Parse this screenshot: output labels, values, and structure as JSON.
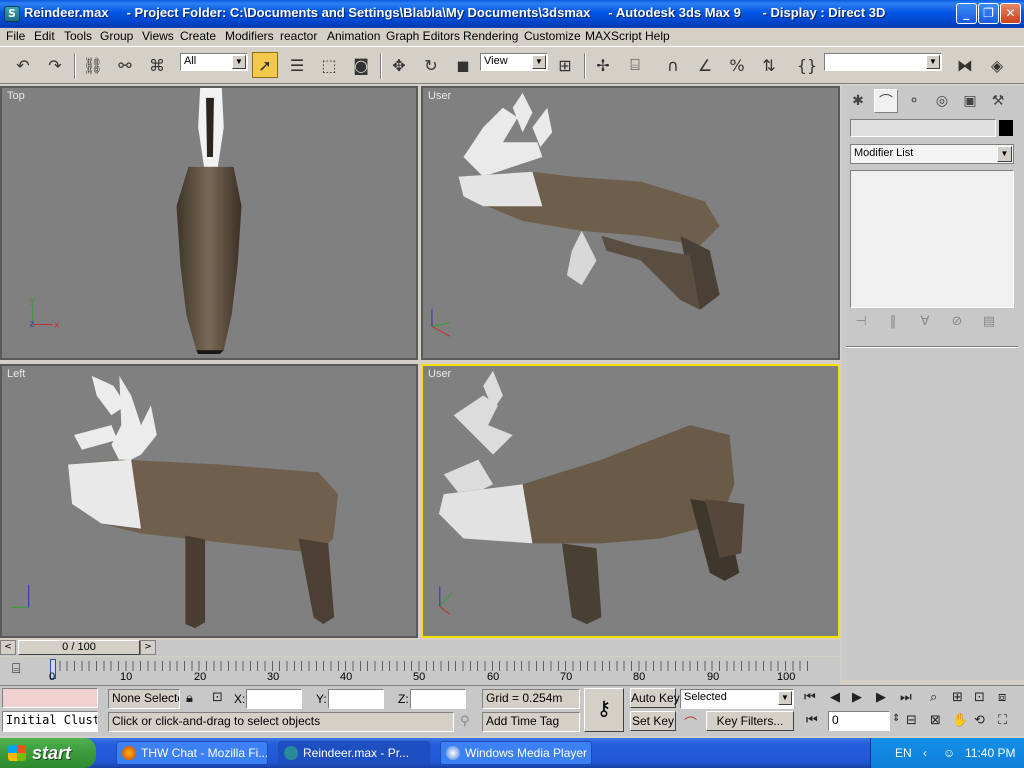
{
  "window": {
    "title": "Reindeer.max     - Project Folder: C:\\Documents and Settings\\Blabla\\My Documents\\3dsmax     - Autodesk 3ds Max 9      - Display : Direct 3D",
    "minimize": "_",
    "maximize": "❐",
    "close": "✕"
  },
  "menu": [
    "File",
    "Edit",
    "Tools",
    "Group",
    "Views",
    "Create",
    "Modifiers",
    "reactor",
    "Animation",
    "Graph Editors",
    "Rendering",
    "Customize",
    "MAXScript",
    "Help"
  ],
  "toolbar": {
    "selection_filter": "All",
    "reference_coord": "View",
    "named_selection": ""
  },
  "viewports": {
    "top_left": "Top",
    "top_right": "User",
    "bottom_left": "Left",
    "bottom_right": "User"
  },
  "command_panel": {
    "modifier_list": "Modifier List"
  },
  "time": {
    "slider_label": "0 / 100",
    "ticks": [
      "0",
      "10",
      "20",
      "30",
      "40",
      "50",
      "60",
      "70",
      "80",
      "90",
      "100"
    ]
  },
  "status": {
    "selection": "None Selecte",
    "x_label": "X:",
    "y_label": "Y:",
    "z_label": "Z:",
    "grid": "Grid = 0.254m",
    "auto_key": "Auto Key",
    "set_key": "Set Key",
    "key_mode": "Selected",
    "key_filters": "Key Filters...",
    "frame": "0",
    "script_listener": "Initial Clust",
    "prompt": "Click or click-and-drag to select objects",
    "add_time_tag": "Add Time Tag"
  },
  "taskbar": {
    "start": "start",
    "tasks": [
      "THW Chat - Mozilla Fi...",
      "Reindeer.max     - Pr...",
      "Windows Media Player"
    ],
    "lang": "EN",
    "clock": "11:40 PM"
  }
}
